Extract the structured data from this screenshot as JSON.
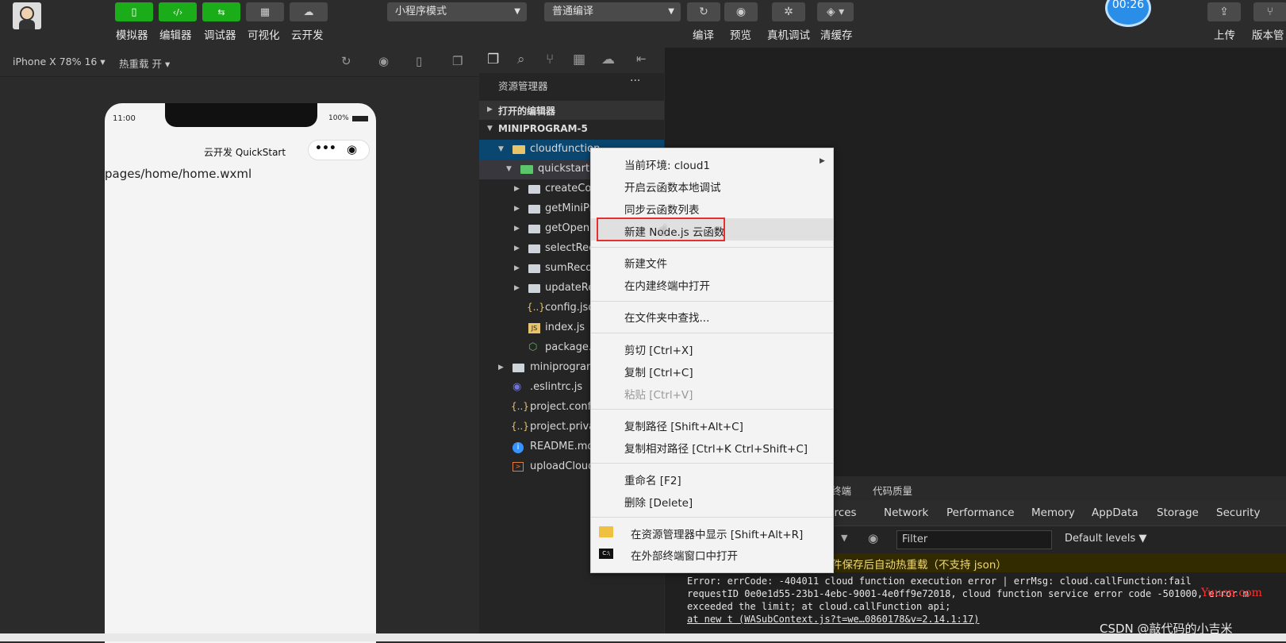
{
  "toolbar": {
    "left_buttons": [
      {
        "label": "模拟器",
        "icon": "phone-icon"
      },
      {
        "label": "编辑器",
        "icon": "code-icon"
      },
      {
        "label": "调试器",
        "icon": "debug-icon"
      },
      {
        "label": "可视化",
        "icon": "layout-icon"
      },
      {
        "label": "云开发",
        "icon": "cloud-icon"
      }
    ],
    "mode_select": "小程序模式",
    "compile_select": "普通编译",
    "right_buttons": [
      {
        "label": "编译",
        "icon": "refresh-icon"
      },
      {
        "label": "预览",
        "icon": "eye-icon"
      },
      {
        "label": "真机调试",
        "icon": "bug-icon"
      },
      {
        "label": "清缓存",
        "icon": "layers-icon"
      }
    ],
    "timer": "00:26",
    "far_right": [
      {
        "label": "上传",
        "icon": "upload-icon"
      },
      {
        "label": "版本管",
        "icon": "branch-icon"
      }
    ]
  },
  "simulator": {
    "device": "iPhone X 78% 16",
    "hot_reload": "热重载 开",
    "status_time": "11:00",
    "battery": "100%",
    "nav_title": "云开发 QuickStart",
    "page_path": "pages/home/home.wxml"
  },
  "explorer": {
    "title": "资源管理器",
    "more": "···",
    "open_editors": "打开的编辑器",
    "project": "MINIPROGRAM-5",
    "items": [
      {
        "label": "cloudfunction",
        "type": "folder-open",
        "level": 1
      },
      {
        "label": "quickstartFu",
        "type": "folder-cloud",
        "level": 2
      },
      {
        "label": "createColl",
        "type": "folder",
        "level": 3
      },
      {
        "label": "getMiniPr",
        "type": "folder",
        "level": 3
      },
      {
        "label": "getOpenId",
        "type": "folder",
        "level": 3
      },
      {
        "label": "selectReco",
        "type": "folder",
        "level": 3
      },
      {
        "label": "sumRecor",
        "type": "folder",
        "level": 3
      },
      {
        "label": "updateRe",
        "type": "folder",
        "level": 3
      },
      {
        "label": "config.json",
        "type": "json",
        "level": 3
      },
      {
        "label": "index.js",
        "type": "js",
        "level": 3
      },
      {
        "label": "package.js",
        "type": "node",
        "level": 3
      },
      {
        "label": "miniprogram",
        "type": "folder",
        "level": 1
      },
      {
        "label": ".eslintrc.js",
        "type": "eslint",
        "level": 1
      },
      {
        "label": "project.config",
        "type": "json",
        "level": 1
      },
      {
        "label": "project.privat",
        "type": "json",
        "level": 1
      },
      {
        "label": "README.md",
        "type": "info",
        "level": 1
      },
      {
        "label": "uploadCloud",
        "type": "shell",
        "level": 1
      }
    ]
  },
  "context_menu": {
    "items": [
      {
        "label": "当前环境: cloud1",
        "submenu": true
      },
      {
        "label": "开启云函数本地调试"
      },
      {
        "label": "同步云函数列表"
      },
      {
        "label": "新建 Node.js 云函数",
        "highlight": true
      },
      {
        "label": "新建文件"
      },
      {
        "label": "在内建终端中打开"
      },
      {
        "label": "在文件夹中查找..."
      },
      {
        "label": "剪切  [Ctrl+X]"
      },
      {
        "label": "复制  [Ctrl+C]"
      },
      {
        "label": "粘贴  [Ctrl+V]",
        "disabled": true
      },
      {
        "label": "复制路径  [Shift+Alt+C]"
      },
      {
        "label": "复制相对路径  [Ctrl+K Ctrl+Shift+C]"
      },
      {
        "label": "重命名  [F2]"
      },
      {
        "label": "删除  [Delete]"
      },
      {
        "label": "在资源管理器中显示  [Shift+Alt+R]"
      },
      {
        "label": "在外部终端窗口中打开"
      }
    ]
  },
  "devtools": {
    "top_tabs": [
      "终端",
      "代码质量"
    ],
    "tabs": [
      "urces",
      "Network",
      "Performance",
      "Memory",
      "AppData",
      "Storage",
      "Security"
    ],
    "filter_placeholder": "Filter",
    "levels": "Default levels",
    "warning": "件保存后自动热重载（不支持 json）",
    "console_lines": [
      "Error: errCode: -404011 cloud function execution error | errMsg: cloud.callFunction:fail",
      "requestID 0e0e1d55-23b1-4ebc-9001-4e0ff9e72018, cloud function service error code -501000, error m",
      "exceeded the limit; at cloud.callFunction api;",
      "    at new t (WASubContext.js?t=we…0860178&v=2.14.1:17)"
    ],
    "watermark1": "Yuucn.com",
    "watermark2": "CSDN @敲代码的小吉米"
  }
}
